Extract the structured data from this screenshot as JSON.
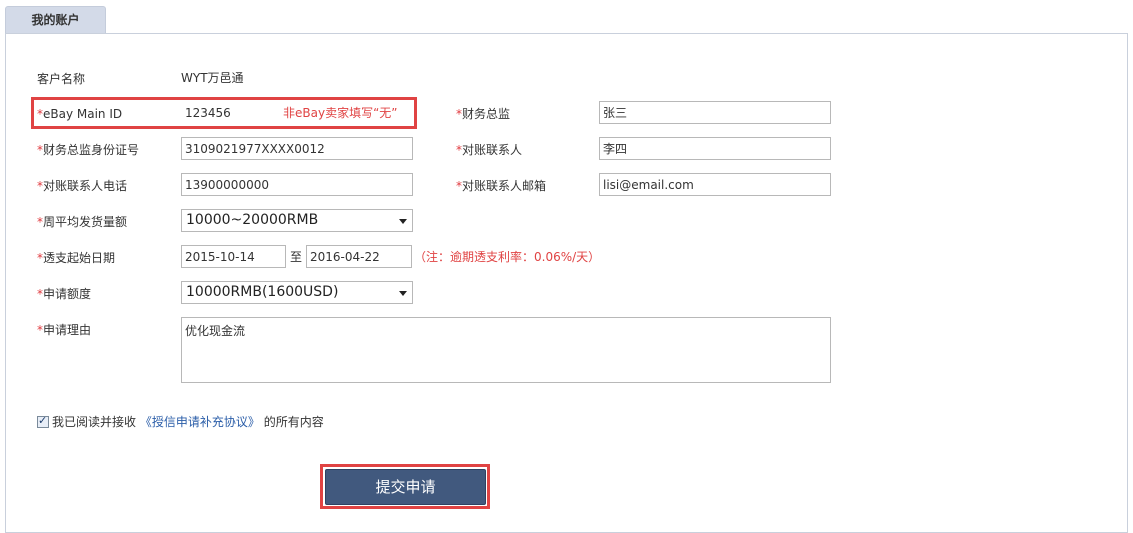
{
  "tab": {
    "label": "我的账户"
  },
  "form": {
    "customer_name": {
      "label": "客户名称",
      "value": "WYT万邑通"
    },
    "ebay_main_id": {
      "label": "eBay Main ID",
      "value": "123456",
      "hint": "非eBay卖家填写“无”"
    },
    "finance_director": {
      "label": "财务总监",
      "value": "张三"
    },
    "finance_director_id": {
      "label": "财务总监身份证号",
      "value": "3109021977XXXX0012"
    },
    "reconciliation_contact": {
      "label": "对账联系人",
      "value": "李四"
    },
    "reconciliation_phone": {
      "label": "对账联系人电话",
      "value": "13900000000"
    },
    "reconciliation_email": {
      "label": "对账联系人邮箱",
      "value": "lisi@email.com"
    },
    "weekly_shipment": {
      "label": "周平均发货量额",
      "value": "10000~20000RMB"
    },
    "overdraft_start": {
      "label": "透支起始日期",
      "start": "2015-10-14",
      "to": "至",
      "end": "2016-04-22",
      "note": "（注：逾期透支利率：0.06%/天）"
    },
    "credit_amount": {
      "label": "申请额度",
      "value": "10000RMB(1600USD)"
    },
    "reason": {
      "label": "申请理由",
      "value": "优化现金流"
    },
    "required_mark": "*"
  },
  "agreement": {
    "checked": true,
    "prefix": "我已阅读并接收",
    "link": "《授信申请补充协议》",
    "suffix": "的所有内容"
  },
  "submit": {
    "label": "提交申请"
  },
  "colors": {
    "accent": "#41597e",
    "required": "#e0393e",
    "highlight": "#e04343",
    "link": "#2a5da8",
    "tab_bg": "#d3dae8"
  }
}
